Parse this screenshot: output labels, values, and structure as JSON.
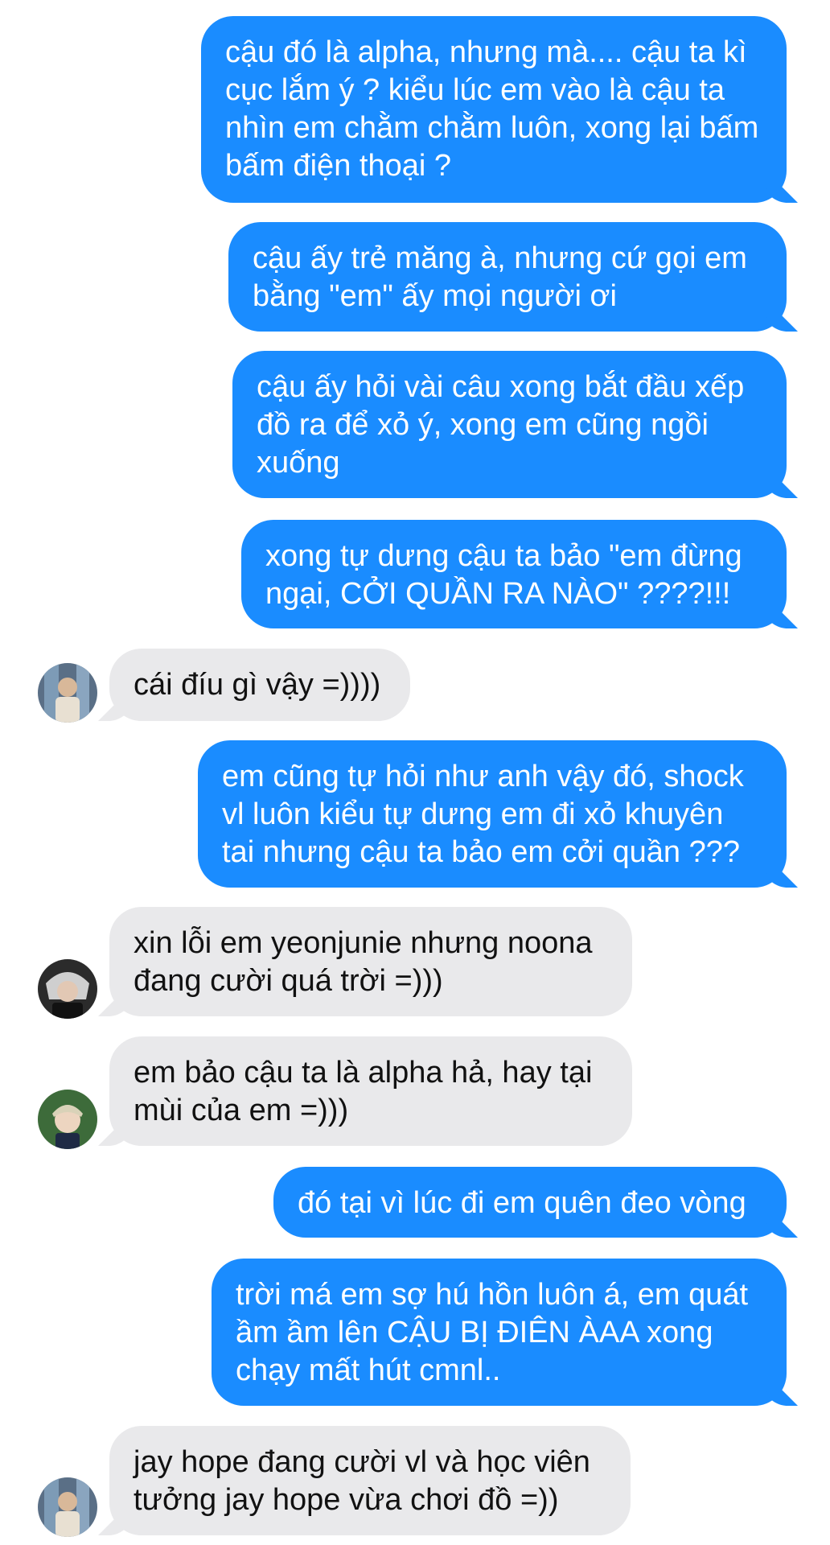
{
  "messages": [
    {
      "from": "me",
      "text": "cậu đó là alpha, nhưng mà.... cậu ta kì cục lắm ý ? kiểu lúc em vào là cậu ta nhìn em chằm chằm luôn, xong lại bấm bấm điện thoại ?"
    },
    {
      "from": "me",
      "text": "cậu ấy trẻ măng à, nhưng cứ gọi em bằng \"em\" ấy mọi người ơi"
    },
    {
      "from": "me",
      "text": "cậu ấy hỏi vài câu xong bắt đầu xếp đồ ra để xỏ ý, xong em cũng ngồi xuống"
    },
    {
      "from": "me",
      "text": "xong tự dưng cậu ta bảo \"em đừng ngại, CỞI QUẦN RA NÀO\" ????!!!"
    },
    {
      "from": "other",
      "avatar": "avatar-1",
      "text": "cái đíu gì vậy =))))"
    },
    {
      "from": "me",
      "text": "em cũng tự hỏi như anh vậy đó, shock vl luôn kiểu tự dưng em đi xỏ khuyên tai nhưng cậu ta bảo em cởi quần ???"
    },
    {
      "from": "other",
      "avatar": "avatar-2",
      "text": "xin lỗi em yeonjunie nhưng noona đang cười quá trời =)))"
    },
    {
      "from": "other",
      "avatar": "avatar-3",
      "text": "em bảo cậu ta là alpha hả, hay tại mùi của em =)))"
    },
    {
      "from": "me",
      "text": "đó tại vì lúc đi em quên đeo vòng"
    },
    {
      "from": "me",
      "text": "trời má em sợ hú hồn luôn á, em quát ầm ầm lên CẬU BỊ ĐIÊN ÀAA xong chạy mất hút cmnl.."
    },
    {
      "from": "other",
      "avatar": "avatar-1",
      "text": "jay hope đang cười vl và học viên tưởng jay hope vừa chơi đồ =))"
    }
  ],
  "colors": {
    "outgoing_bubble": "#1a8cff",
    "incoming_bubble": "#e9e9eb",
    "outgoing_text": "#ffffff",
    "incoming_text": "#111111"
  }
}
